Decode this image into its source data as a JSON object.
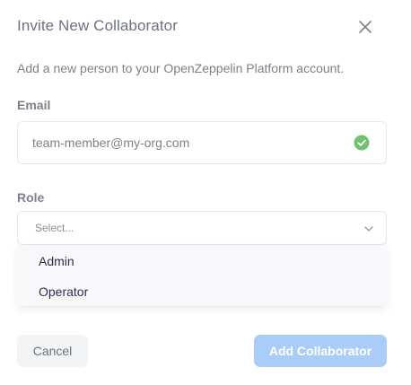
{
  "dialog": {
    "title": "Invite New Collaborator",
    "description": "Add a new person to your OpenZeppelin Platform account.",
    "close_icon": "close-icon"
  },
  "email": {
    "label": "Email",
    "value": "team-member@my-org.com",
    "status_icon": "check-circle-icon",
    "status_color": "#6fc26f"
  },
  "role": {
    "label": "Role",
    "placeholder": "Select...",
    "icon": "chevron-down-icon",
    "options": [
      "Admin",
      "Operator"
    ]
  },
  "actions": {
    "cancel_label": "Cancel",
    "submit_label": "Add Collaborator",
    "submit_color": "#a9cdf7"
  }
}
